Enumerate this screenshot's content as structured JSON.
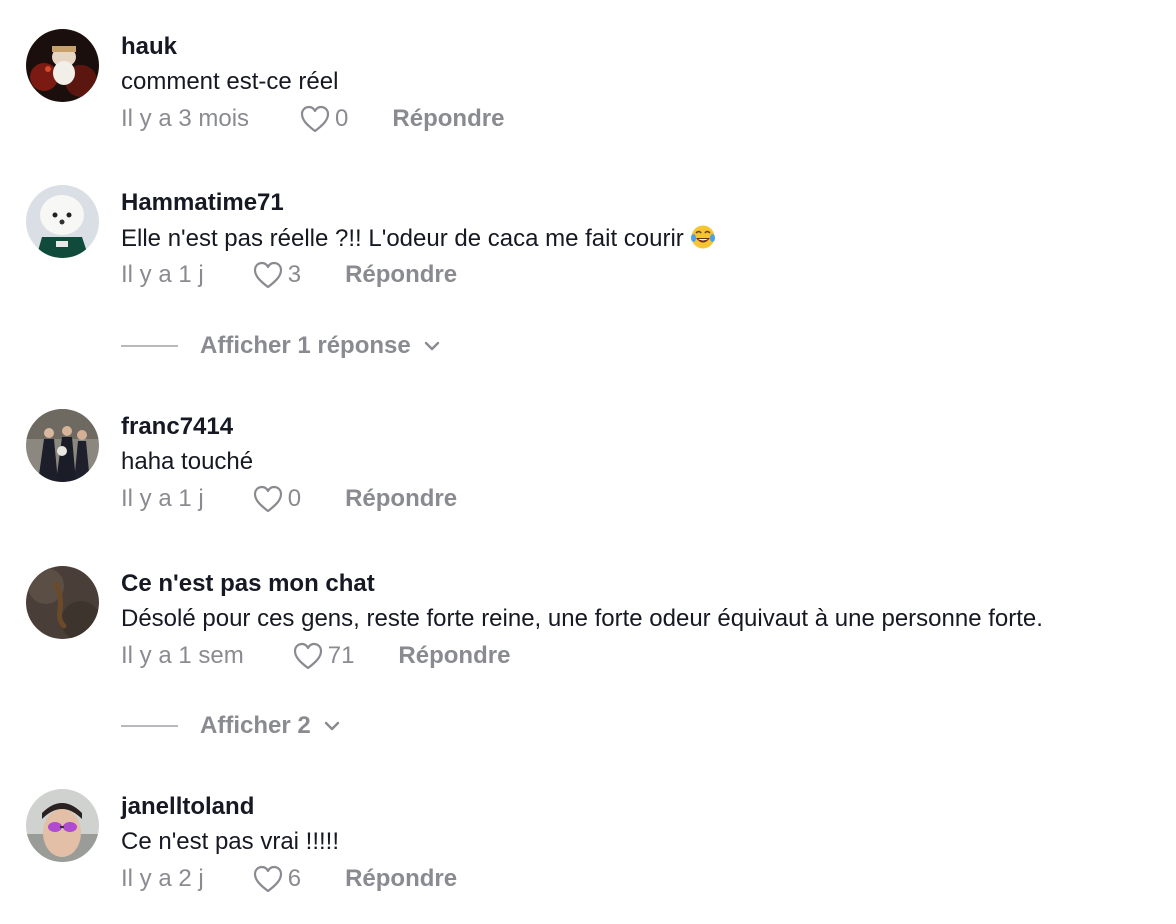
{
  "comments": [
    {
      "username": "hauk",
      "text": "comment est-ce réel",
      "time": "Il y a 3 mois",
      "likes": "0",
      "reply": "Répondre"
    },
    {
      "username": "Hammatime71",
      "text": "Elle n'est pas réelle ?!! L'odeur de caca me fait courir",
      "emoji": "face-with-tears-of-joy",
      "time": "Il y a 1 j",
      "likes": "3",
      "reply": "Répondre",
      "view_replies": "Afficher 1 réponse"
    },
    {
      "username": "franc7414",
      "text": "haha touché",
      "time": "Il y a 1 j",
      "likes": "0",
      "reply": "Répondre"
    },
    {
      "username": "Ce n'est pas mon chat",
      "text": "Désolé pour ces gens, reste forte reine, une forte odeur équivaut à une personne forte.",
      "time": "Il y a 1 sem",
      "likes": "71",
      "reply": "Répondre",
      "view_replies": "Afficher 2"
    },
    {
      "username": "janelltoland",
      "text": "Ce n'est pas vrai !!!!!",
      "time": "Il y a 2 j",
      "likes": "6",
      "reply": "Répondre"
    }
  ],
  "icons": {
    "like": "heart-outline-icon",
    "expand": "chevron-down-icon"
  },
  "colors": {
    "text": "#161823",
    "secondary": "#8a8b91",
    "background": "#ffffff"
  }
}
